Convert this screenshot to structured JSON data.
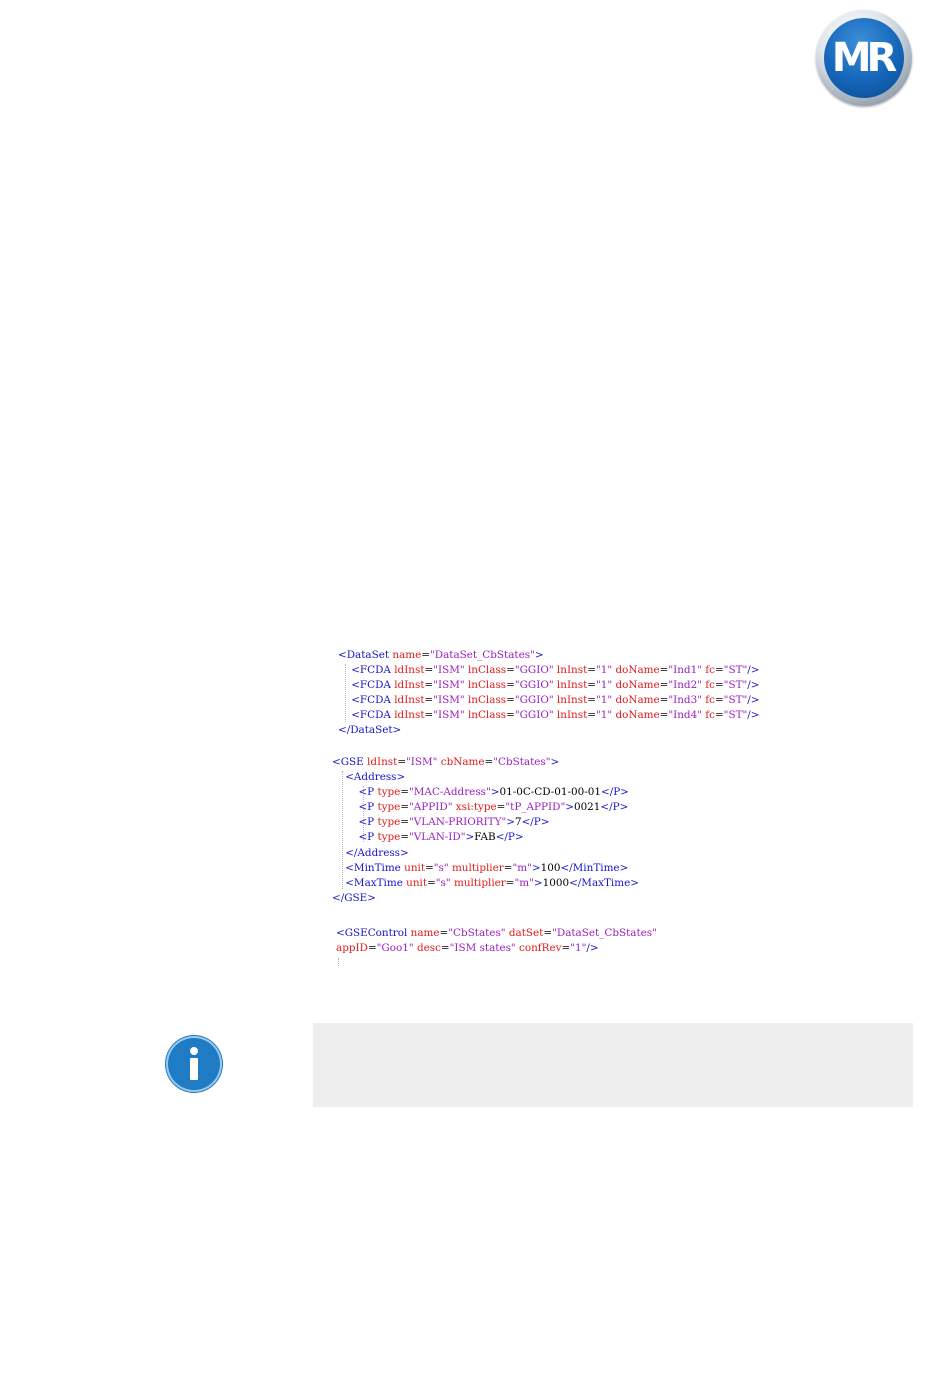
{
  "logo": {
    "text": "MR"
  },
  "code": {
    "dataset": [
      [
        "tag-open|<",
        "t|DataSet",
        "a| name",
        "x|=",
        "v|\"DataSet_CbStates\"",
        "t|>"
      ],
      [
        "x|    ",
        "t|<FCDA",
        "a| ldInst",
        "x|=",
        "v|\"ISM\"",
        "a| lnClass",
        "x|=",
        "v|\"GGIO\"",
        "a| lnInst",
        "x|=",
        "v|\"1\"",
        "a| doName",
        "x|=",
        "v|\"Ind1\"",
        "a| fc",
        "x|=",
        "v|\"ST\"",
        "t|/>"
      ],
      [
        "x|    ",
        "t|<FCDA",
        "a| ldInst",
        "x|=",
        "v|\"ISM\"",
        "a| lnClass",
        "x|=",
        "v|\"GGIO\"",
        "a| lnInst",
        "x|=",
        "v|\"1\"",
        "a| doName",
        "x|=",
        "v|\"Ind2\"",
        "a| fc",
        "x|=",
        "v|\"ST\"",
        "t|/>"
      ],
      [
        "x|    ",
        "t|<FCDA",
        "a| ldInst",
        "x|=",
        "v|\"ISM\"",
        "a| lnClass",
        "x|=",
        "v|\"GGIO\"",
        "a| lnInst",
        "x|=",
        "v|\"1\"",
        "a| doName",
        "x|=",
        "v|\"Ind3\"",
        "a| fc",
        "x|=",
        "v|\"ST\"",
        "t|/>"
      ],
      [
        "x|    ",
        "t|<FCDA",
        "a| ldInst",
        "x|=",
        "v|\"ISM\"",
        "a| lnClass",
        "x|=",
        "v|\"GGIO\"",
        "a| lnInst",
        "x|=",
        "v|\"1\"",
        "a| doName",
        "x|=",
        "v|\"Ind4\"",
        "a| fc",
        "x|=",
        "v|\"ST\"",
        "t|/>"
      ],
      [
        "t|</DataSet>"
      ]
    ],
    "gse": [
      [
        "t|<GSE",
        "a| ldInst",
        "x|=",
        "v|\"ISM\"",
        "a| cbName",
        "x|=",
        "v|\"CbStates\"",
        "t|>"
      ],
      [
        "x|    ",
        "t|<Address>"
      ],
      [
        "x|        ",
        "t|<P",
        "a| type",
        "x|=",
        "v|\"MAC-Address\"",
        "t|>",
        "x|01-0C-CD-01-00-01",
        "t|</P>"
      ],
      [
        "x|        ",
        "t|<P",
        "a| type",
        "x|=",
        "v|\"APPID\"",
        "a| xsi:type",
        "x|=",
        "v|\"tP_APPID\"",
        "t|>",
        "x|0021",
        "t|</P>"
      ],
      [
        "x|        ",
        "t|<P",
        "a| type",
        "x|=",
        "v|\"VLAN-PRIORITY\"",
        "t|>",
        "x|7",
        "t|</P>"
      ],
      [
        "x|        ",
        "t|<P",
        "a| type",
        "x|=",
        "v|\"VLAN-ID\"",
        "t|>",
        "x|FAB",
        "t|</P>"
      ],
      [
        "x|    ",
        "t|</Address>"
      ],
      [
        "x|    ",
        "t|<MinTime",
        "a| unit",
        "x|=",
        "v|\"s\"",
        "a| multiplier",
        "x|=",
        "v|\"m\"",
        "t|>",
        "x|100",
        "t|</MinTime>"
      ],
      [
        "x|    ",
        "t|<MaxTime",
        "a| unit",
        "x|=",
        "v|\"s\"",
        "a| multiplier",
        "x|=",
        "v|\"m\"",
        "t|>",
        "x|1000",
        "t|</MaxTime>"
      ],
      [
        "t|</GSE>"
      ]
    ],
    "gsecontrol": [
      [
        "t|<GSEControl",
        "a| name",
        "x|=",
        "v|\"CbStates\"",
        "a| datSet",
        "x|=",
        "v|\"DataSet_CbStates\""
      ],
      [
        "a|appID",
        "x|=",
        "v|\"Goo1\"",
        "a| desc",
        "x|=",
        "v|\"ISM states\"",
        "a| confRev",
        "x|=",
        "v|\"1\"",
        "t|/>"
      ]
    ]
  },
  "colors": {
    "tag": "#1515c8",
    "attribute": "#e01b1b",
    "value": "#9a1fbf",
    "info_icon": "#1f7cc4",
    "info_box": "#eeeeee"
  },
  "info": {
    "icon": "info-icon"
  }
}
